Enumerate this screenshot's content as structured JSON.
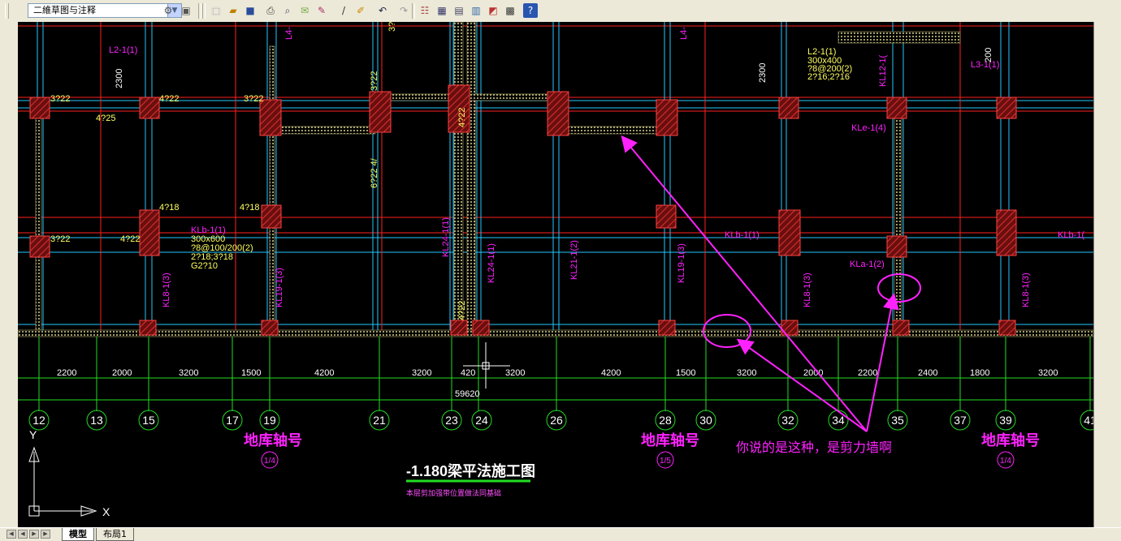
{
  "toolbar": {
    "workspace_value": "二維草图与注释",
    "tools": [
      "new-icon",
      "open-icon",
      "save-icon",
      "plot-icon",
      "preview-icon",
      "publish-icon",
      "match-icon",
      "pencil-icon",
      "brush-icon",
      "undo-icon",
      "redo-icon",
      "properties-icon",
      "design-center-icon",
      "tool-palette-icon",
      "sheet-set-icon",
      "markup-icon",
      "calculator-icon",
      "help-icon"
    ]
  },
  "drawing": {
    "title": "-1.180梁平法施工图",
    "subtitle": "本层剪加强带位置做法同基础",
    "total_dimension": "59620",
    "dimensions": [
      "2200",
      "2000",
      "3200",
      "1500",
      "4200",
      "3200",
      "420",
      "3200",
      "4200",
      "1500",
      "3200",
      "2000",
      "2200",
      "2400",
      "1800",
      "3200"
    ],
    "axes": [
      "12",
      "13",
      "15",
      "17",
      "19",
      "21",
      "23",
      "24",
      "26",
      "28",
      "30",
      "32",
      "34",
      "35",
      "37",
      "39",
      "41"
    ],
    "axis_callouts": [
      {
        "label": "地库轴号",
        "ref": "1/4"
      },
      {
        "label": "地库轴号",
        "ref": "1/5"
      },
      {
        "label": "地库轴号",
        "ref": "1/4"
      }
    ],
    "annotation_note": "你说的是这种，是剪力墙啊",
    "beam_labels": {
      "kl2": "L2-1(1)",
      "kl2b": "L2-1(1)",
      "kl2b_size": "300x400",
      "kl2b_stirrup": "?8@200(2)",
      "kl2b_bars": "2?16;2?16",
      "kl3": "L3-1(1)",
      "kle": "KLe-1(4)",
      "klb1": "KLb-1(1)",
      "klb1_size": "300x600",
      "klb1_stirrup": "?8@100/200(2)",
      "klb1_bars": "2?18;3?18",
      "klb1_g": "G2?10",
      "klb2": "KLb-1(1)",
      "klb3": "KLb-1(",
      "kla": "KLa-1(2)",
      "kl19": "KL19-1(3)",
      "kl19b": "KL19-1(3)",
      "kl21": "KL21-1(2)",
      "kl24": "KL24-1(1)",
      "kl24b": "KL24-1(1)",
      "kl8a": "KL8-1(3)",
      "kl8b": "KL8-1(3)",
      "kl8c": "KL8-1(3)",
      "kl12": "KL12-1(",
      "l4a": "L4-",
      "l4b": "L4-",
      "r1": "3?22",
      "r2": "4?22",
      "r3": "3?22",
      "r4": "4?25",
      "r5": "3?22",
      "r6": "4?22",
      "r7": "6?22 4/",
      "r8": "4?18",
      "r9": "4?18",
      "r10": "3?22",
      "r11": "4?22",
      "r12": "4?22",
      "r13": "3?",
      "d2300a": "2300",
      "d2300b": "2300",
      "d200": "200"
    }
  },
  "ucs": {
    "x_label": "X",
    "y_label": "Y"
  },
  "tabs": {
    "model": "模型",
    "layout1": "布局1"
  }
}
